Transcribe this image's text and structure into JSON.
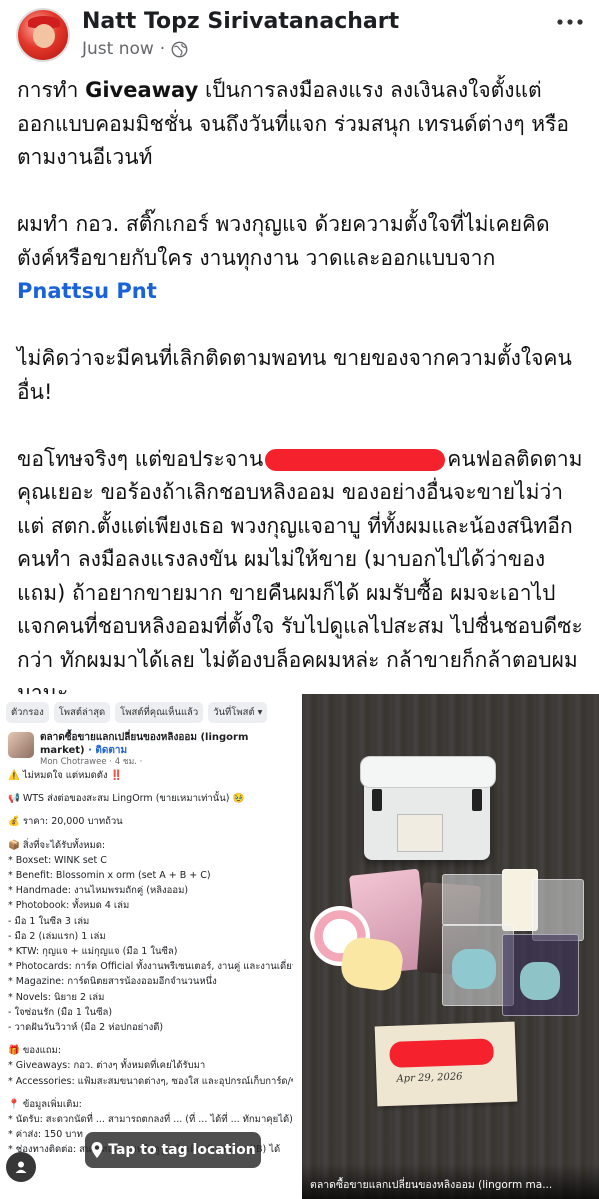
{
  "author": {
    "name": "Natt Topz Sirivatanachart",
    "timestamp": "Just now",
    "separator": "·",
    "privacy_icon": "globe-icon",
    "more_icon": "ellipsis-icon"
  },
  "post": {
    "para1_pre": "การทำ ",
    "para1_bold": "Giveaway",
    "para1_post": " เป็นการลงมือลงแรง ลงเงินลงใจตั้งแต่ออกแบบคอมมิชชั่น จนถึงวันที่แจก ร่วมสนุก เทรนด์ต่างๆ หรือตามงานอีเวนท์",
    "para2": "ผมทำ กอว. สติ๊กเกอร์ พวงกุญแจ ด้วยความตั้งใจที่ไม่เคยคิดตังค์หรือขายกับใคร งานทุกงาน วาดและออกแบบจาก",
    "para2_link": "Pnattsu Pnt",
    "para3": "ไม่คิดว่าจะมีคนที่เลิกติดตามพอทน ขายของจากความตั้งใจคนอื่น!",
    "para4_pre": "ขอโทษจริงๆ แต่ขอประจาน",
    "para4_post": "คนฟอลติดตามคุณเยอะ ขอร้องถ้าเลิกชอบหลิงออม ของอย่างอื่นจะขายไม่ว่า แต่ สตก.ตั้งแต่เพียงเธอ พวงกุญแจอาบู ที่ทั้งผมและน้องสนิทอีกคนทำ ลงมือลงแรงลงขัน ผมไม่ให้ขาย (มาบอกไปได้ว่าของแถม) ถ้าอยากขายมาก ขายคืนผมก็ได้ ผมรับซื้อ ผมจะเอาไปแจกคนที่ชอบหลิงออมที่ตั้งใจ รับไปดูแลไปสะสม ไปชื่นชอบดีซะกว่า ทักผมมาได้เลย ไม่ต้องบล็อคผมหล่ะ กล้าขายก็กล้าตอบผมมานะ"
  },
  "left_image": {
    "chips": [
      "ตัวกรอง",
      "โพสต์ล่าสุด",
      "โพสต์ที่คุณเห็นแล้ว",
      "วันที่โพสต์ ▾"
    ],
    "group_name": "ตลาดซื้อขายแลกเปลี่ยนของหลิงออม (lingorm market)",
    "group_follow": "· ติดตาม",
    "poster": "Mon Chotrawee · 4 ชม. · ",
    "lines": [
      "⚠️ ไม่หมดใจ แต่หมดตัง ‼️",
      "",
      "📢 WTS ส่งต่อของสะสม LingOrm (ขายเหมาเท่านั้น) 🥹",
      "",
      "💰 ราคา: 20,000 บาทถ้วน",
      "",
      "📦 สิ่งที่จะได้รับทั้งหมด:",
      "* Boxset: WINK set C",
      "* Benefit: Blossomin x orm (set A + B + C)",
      "* Handmade: งานไหมพรมถักคู่ (หลิงออม)",
      "* Photobook: ทั้งหมด 4 เล่ม",
      "   - มือ 1 ในซีล 3 เล่ม",
      "   - มือ 2 (เล่มแรก) 1 เล่ม",
      "* KTW: กุญแจ + แม่กุญแจ (มือ 1 ในซีล)",
      "* Photocards: การ์ด Official ทั้งงานพรีเซนเตอร์, งานคู่ และงานเดี่ยว (ตามภาพ)",
      "* Magazine: การ์ดนิตยสารน้องออมอีกจำนวนหนึ่ง",
      "* Novels: นิยาย 2 เล่ม",
      "   - ใจซ่อนรัก (มือ 1 ในซีล)",
      "   - วาดฝันวันวิวาห์ (มือ 2 ห่อปกอย่างดี)",
      "",
      "🎁 ของแถม:",
      "* Giveaways: กอว. ต่างๆ ทั้งหมดที่เคยได้รับมา",
      "* Accessories: แฟ้มสะสมขนาดต่างๆ, ซองใส และอุปกรณ์เก็บการ์ด/ของสะสม",
      "",
      "📍 ข้อมูลเพิ่มเติม:",
      "* นัดรับ: สะดวกนัดที่ ... สามารถตกลงที่ ... (ที่ ... ได้ที่ ... ทักมาคุยได้)",
      "* ค่าส่ง: 150 บาท",
      "* ช่องทางติดต่อ: สนใจสอบถามหรือดูรูปเพิ่มเติม ทัก Inbox (IB) ได้"
    ],
    "tag_label": "Tap to tag location",
    "tag_icon": "location-icon",
    "person_icon": "person-icon"
  },
  "right_image": {
    "envelope_date": "Apr 29, 2026",
    "caption": "ตลาดซื้อขายแลกเปลี่ยนของหลิงออม (lingorm ma..."
  },
  "colors": {
    "link": "#1a62d8",
    "redaction": "#f5222d",
    "meta_gray": "#65676b"
  }
}
